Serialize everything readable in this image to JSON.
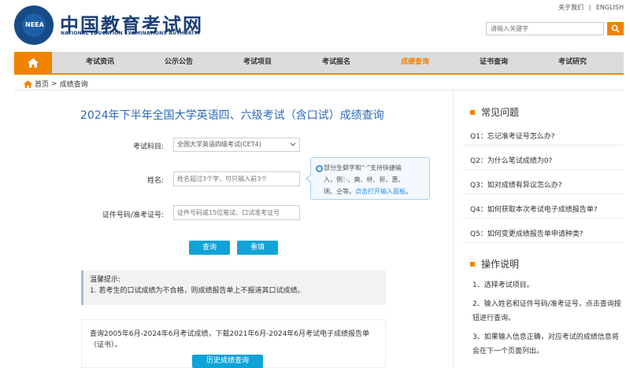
{
  "header": {
    "logo_text": "NEEA",
    "title": "中国教育考试网",
    "subtitle": "NATIONAL EDUCATION EXAMINATIONS AUTHORITY",
    "top_links": [
      "关于我们",
      "|",
      "ENGLISH"
    ],
    "search_placeholder": "请输入关键字"
  },
  "nav": {
    "items": [
      "考试资讯",
      "公示公告",
      "考试项目",
      "考试报名",
      "成绩查询",
      "证书查询",
      "考试研究"
    ],
    "active_index": 4
  },
  "breadcrumb": {
    "home": "首页",
    "sep": ">",
    "current": "成绩查询"
  },
  "main": {
    "title": "2024年下半年全国大学英语四、六级考试（含口试）成绩查询",
    "subject_label": "考试科目:",
    "subject_value": "全国大学英语四级考试(CET4)",
    "name_label": "姓名:",
    "name_placeholder": "姓名超过3个字，可只输入前3个",
    "id_label": "证件号码/准考证号:",
    "id_placeholder": "证件号码或15位笔试、口试准考证号",
    "tip_line1": "部分生僻字和“·”支持快捷输",
    "tip_line2": "入，例：·、奭、栟、祈、惠、",
    "tip_line3_prefix": "琍、仝等。",
    "tip_link": "点击打开输入面板",
    "tip_line3_suffix": "。",
    "query_button": "查询",
    "reset_button": "重填",
    "notice_title": "温馨提示:",
    "notice_text": "1. 若考生的口试成绩为不合格，则成绩报告单上不报道其口试成绩。",
    "history_text": "查询2005年6月-2024年6月考试成绩，下载2021年6月-2024年6月考试电子成绩报告单（证书）。",
    "history_button": "历史成绩查询"
  },
  "sidebar": {
    "faq_title": "常见问题",
    "faq": [
      "Q1：忘记准考证号怎么办?",
      "Q2：为什么笔试成绩为0?",
      "Q3：如对成绩有异议怎么办?",
      "Q4：如何获取本次考试电子成绩报告单?",
      "Q5：如何变更成绩报告单申请种类?"
    ],
    "ops_title": "操作说明",
    "steps": [
      "1、选择考试项目。",
      "2、输入姓名和证件号码/准考证号，点击查询按钮进行查询。",
      "3、如果输入信息正确，对应考试的成绩信息将会在下一个页面列出。"
    ]
  },
  "colors": {
    "brand_blue": "#1b3f78",
    "accent_orange": "#f08300",
    "button_blue": "#0fa3d8",
    "title_blue": "#2a6bb8"
  },
  "icons": [
    "home-icon",
    "search-icon",
    "chevron-down-icon",
    "info-dot-icon"
  ]
}
